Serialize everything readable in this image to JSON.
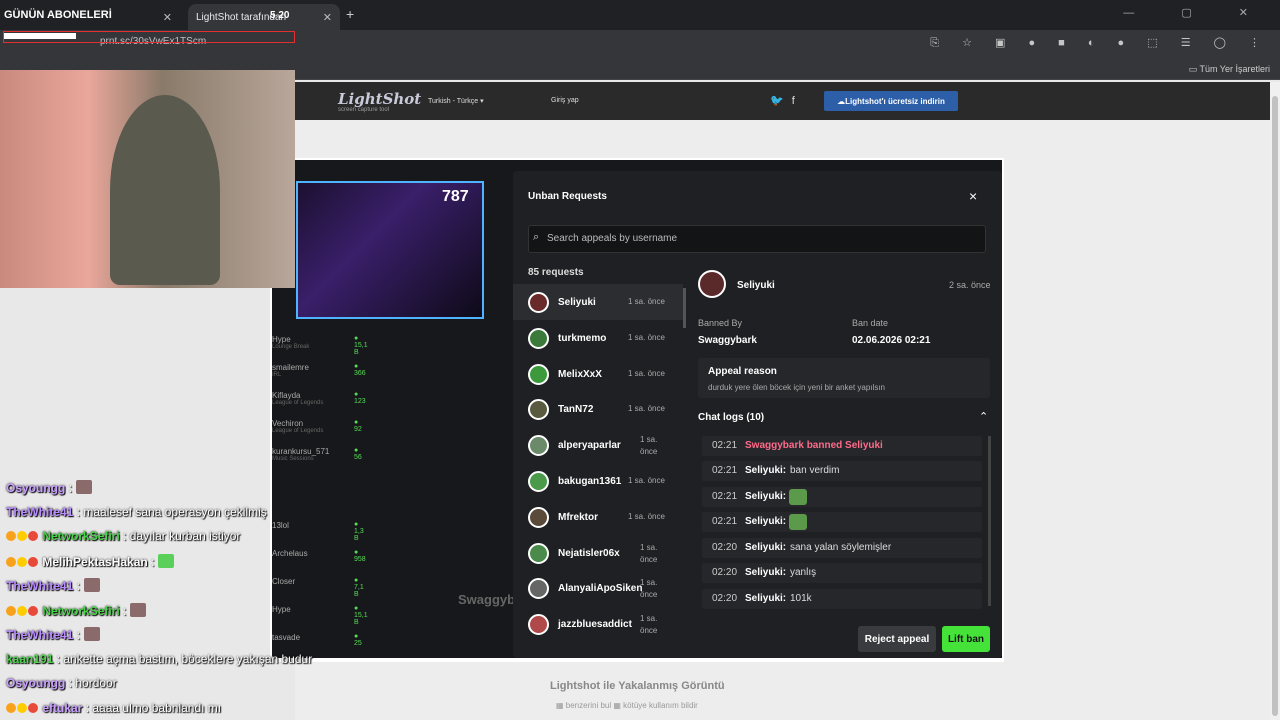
{
  "browser": {
    "tab1_title": "GÜNÜN ABONELERİ",
    "tab2_title": "LightShot tarafından",
    "tab_overlay_count": "5 20",
    "url": "prnt.sc/30sVwEx1TScm",
    "bookmarks_label": "Tüm Yer İşaretleri"
  },
  "lightshot": {
    "logo": "LightShot",
    "logo_sub": "screen capture tool",
    "language": "Turkish - Türkçe",
    "login": "Giriş yap",
    "download_button": "Lightshot'ı ücretsiz indirin",
    "caption_title": "Lightshot ile Yakalanmış Görüntü",
    "caption_links": "▦ benzerini bul   ▦ kötüye kullanım bildir"
  },
  "background_stream": {
    "viewer_count": "787",
    "channel_name": "Swaggyb",
    "sidebar": [
      {
        "name": "Hype",
        "sub": "Lounge Break",
        "count": "15,1 B"
      },
      {
        "name": "smailemre",
        "sub": "IRL",
        "count": "366"
      },
      {
        "name": "Kiflayda",
        "sub": "League of Legends",
        "count": "123"
      },
      {
        "name": "Vechiron",
        "sub": "League of Legends",
        "count": "92"
      },
      {
        "name": "kurankursu_571",
        "sub": "Music Sessions",
        "count": "56"
      },
      {
        "name": "13lol",
        "sub": "",
        "count": "1,3 B"
      },
      {
        "name": "Archelaus",
        "sub": "",
        "count": "958"
      },
      {
        "name": "Closer",
        "sub": "",
        "count": "7,1 B"
      },
      {
        "name": "Hype",
        "sub": "",
        "count": "15,1 B"
      },
      {
        "name": "tasvade",
        "sub": "",
        "count": "25"
      }
    ]
  },
  "modal": {
    "title": "Unban Requests",
    "close": "×",
    "search_placeholder": "Search appeals by username",
    "request_count": "85 requests",
    "requests": [
      {
        "user": "Seliyuki",
        "time": "1 sa. önce"
      },
      {
        "user": "turkmemo",
        "time": "1 sa. önce"
      },
      {
        "user": "MelixXxX",
        "time": "1 sa. önce"
      },
      {
        "user": "TanN72",
        "time": "1 sa. önce"
      },
      {
        "user": "alperyaparlar",
        "time": "1 sa. önce"
      },
      {
        "user": "bakugan1361",
        "time": "1 sa. önce"
      },
      {
        "user": "Mfrektor",
        "time": "1 sa. önce"
      },
      {
        "user": "Nejatisler06x",
        "time": "1 sa. önce"
      },
      {
        "user": "AlanyaliApoSiken",
        "time": "1 sa. önce"
      },
      {
        "user": "jazzbluesaddict",
        "time": "1 sa. önce"
      }
    ],
    "detail": {
      "user": "Seliyuki",
      "time": "2 sa. önce",
      "banned_by_label": "Banned By",
      "banned_by": "Swaggybark",
      "ban_date_label": "Ban date",
      "ban_date": "02.06.2026 02:21",
      "appeal_label": "Appeal reason",
      "appeal_text": "durduk yere ölen böcek için yeni bir anket yapılsın",
      "chat_logs_label": "Chat logs (10)",
      "chat_logs": [
        {
          "time": "02:21",
          "user": "Swaggybark banned Seliyuki",
          "msg": ""
        },
        {
          "time": "02:21",
          "user": "Seliyuki:",
          "msg": "ban verdim"
        },
        {
          "time": "02:21",
          "user": "Seliyuki:",
          "msg": ""
        },
        {
          "time": "02:21",
          "user": "Seliyuki:",
          "msg": ""
        },
        {
          "time": "02:20",
          "user": "Seliyuki:",
          "msg": "sana yalan söylemişler"
        },
        {
          "time": "02:20",
          "user": "Seliyuki:",
          "msg": "yanlış"
        },
        {
          "time": "02:20",
          "user": "Seliyuki:",
          "msg": "101k"
        }
      ]
    },
    "reject_button": "Reject appeal",
    "lift_button": "Lift ban"
  },
  "stream_chat": [
    {
      "user": "Osyoungg",
      "text": ":",
      "color": "#c9a0ff"
    },
    {
      "user": "TheWhite41",
      "text": ": maalesef sana operasyon çekilmiş",
      "color": "#b98cff"
    },
    {
      "user": "NetworkSefiri",
      "text": ": dayılar kurban istiyor",
      "color": "#4bd44b"
    },
    {
      "user": "MelihPektasHakan",
      "text": ":",
      "color": "#ffffff"
    },
    {
      "user": "TheWhite41",
      "text": ":",
      "color": "#b98cff"
    },
    {
      "user": "NetworkSefiri",
      "text": ":",
      "color": "#4bd44b"
    },
    {
      "user": "TheWhite41",
      "text": ":",
      "color": "#b98cff"
    },
    {
      "user": "kaan191",
      "text": ": ankette açma bastım, böceklere yakışan budur",
      "color": "#4bd44b"
    },
    {
      "user": "Osyoungg",
      "text": ": hordoor",
      "color": "#c9a0ff"
    },
    {
      "user": "eftukar",
      "text": ": aaaa ulmo babnlandı mı",
      "color": "#c9a0ff"
    }
  ]
}
